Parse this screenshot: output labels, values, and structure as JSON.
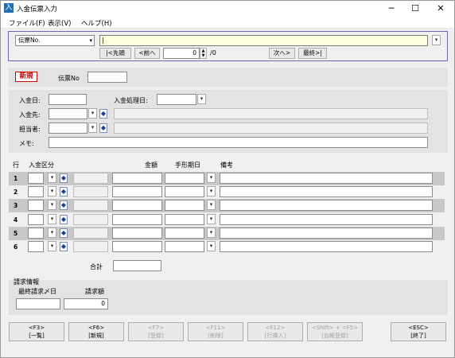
{
  "window": {
    "title": "入金伝票入力",
    "minimize_glyph": "─",
    "maximize_glyph": "☐",
    "close_glyph": "✕"
  },
  "menu": [
    "ファイル(F)",
    "表示(V)",
    "ヘルプ(H)"
  ],
  "search": {
    "type_value": "伝票No.",
    "query_value": "|",
    "first_label": "|<先頭",
    "prev_label": "<前へ",
    "position_value": "0",
    "total_text": "/0",
    "next_label": "次へ>",
    "last_label": "最終>|"
  },
  "mode": {
    "badge": "新規",
    "slip_no_label": "伝票No",
    "slip_no_value": ""
  },
  "header": {
    "receipt_date_label": "入金日:",
    "process_date_label": "入金処理日:",
    "payer_label": "入金先:",
    "staff_label": "担当者:",
    "memo_label": "メモ:"
  },
  "grid": {
    "columns": {
      "row": "行",
      "category": "入金区分",
      "amount": "金額",
      "bill_due_date": "手形期日",
      "remarks": "備考"
    },
    "rows": [
      {
        "no": "1",
        "shaded": true
      },
      {
        "no": "2",
        "shaded": false
      },
      {
        "no": "3",
        "shaded": true
      },
      {
        "no": "4",
        "shaded": false
      },
      {
        "no": "5",
        "shaded": true
      },
      {
        "no": "6",
        "shaded": false
      }
    ]
  },
  "total": {
    "label": "合計",
    "value": ""
  },
  "billing": {
    "section_title": "請求情報",
    "last_billing_date_label": "最終請求〆日",
    "billing_amount_label": "請求額",
    "last_billing_date_value": "",
    "billing_amount_value": "0"
  },
  "function_keys": [
    {
      "key": "<F3>",
      "label": "[一覧]",
      "enabled": true
    },
    {
      "key": "<F6>",
      "label": "[新規]",
      "enabled": true
    },
    {
      "key": "<F7>",
      "label": "[登録]",
      "enabled": false
    },
    {
      "key": "<F11>",
      "label": "[削除]",
      "enabled": false
    },
    {
      "key": "<F12>",
      "label": "[行挿入]",
      "enabled": false
    },
    {
      "key": "<Shift> + <F5>",
      "label": "[台帳登録]",
      "enabled": false
    },
    {
      "key": "<ESC>",
      "label": "[終了]",
      "enabled": true
    }
  ],
  "colors": {
    "accent_border": "#6b6bb5",
    "query_bg": "#ffffe1",
    "badge_red": "#d40000",
    "row_shade": "#c8c8c8"
  },
  "icons": {
    "dropdown": "▾",
    "lookup": "◆",
    "spin_up": "▲",
    "spin_down": "▼"
  }
}
